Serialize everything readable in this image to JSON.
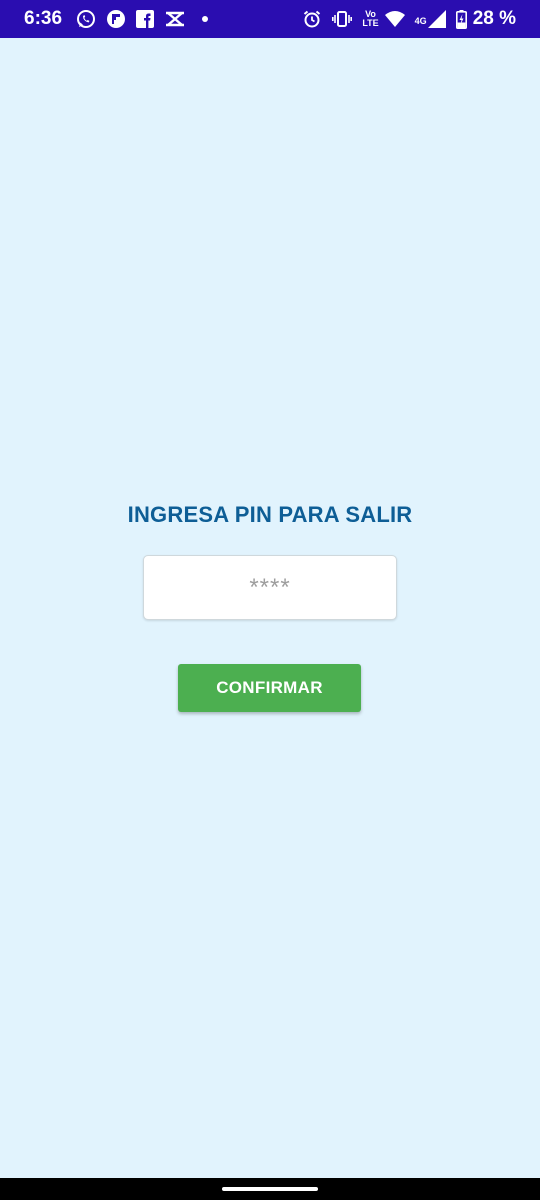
{
  "colors": {
    "status_bar_bg": "#2A0DB0",
    "screen_bg": "#E1F3FD",
    "title_color": "#0E5E96",
    "button_bg": "#4CAF50",
    "nav_bar_bg": "#000000"
  },
  "status_bar": {
    "time": "6:36",
    "left_icons": [
      "whatsapp-icon",
      "flipboard-icon",
      "facebook-icon",
      "capcut-icon",
      "notification-dot-icon"
    ],
    "right_icons": [
      "alarm-icon",
      "vibrate-icon",
      "volte-icon",
      "wifi-icon",
      "signal-icon",
      "battery-icon"
    ],
    "volte_top": "Vo",
    "volte_bottom": "LTE",
    "network_type": "4G",
    "battery_percent": "28 %"
  },
  "main": {
    "title": "INGRESA PIN PARA SALIR",
    "pin_input": {
      "value": "",
      "placeholder": "****"
    },
    "confirm_button_label": "CONFIRMAR"
  }
}
